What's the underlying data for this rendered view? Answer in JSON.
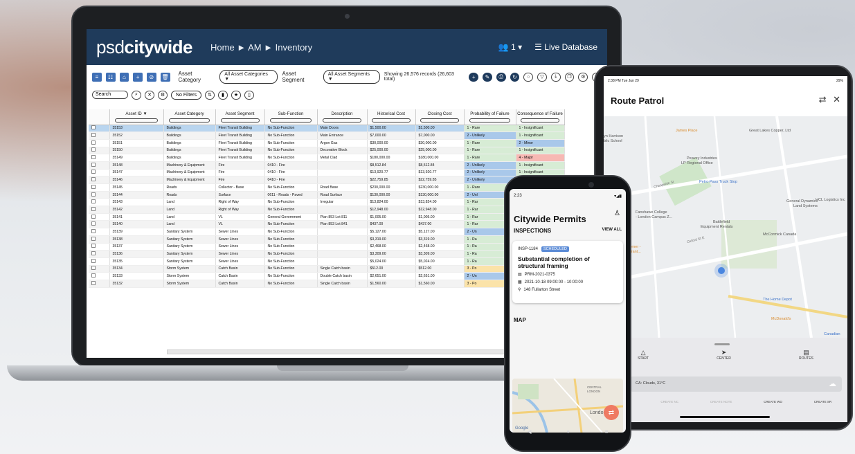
{
  "laptop": {
    "app": {
      "logo_light": "psd",
      "logo_bold": "citywide",
      "breadcrumb": "Home ► AM ► Inventory",
      "user_count": "1 ▾",
      "database": "Live Database"
    },
    "toolbar": {
      "asset_category_label": "Asset Category",
      "asset_category_value": "All Asset Categories ▼",
      "asset_segment_label": "Asset Segment",
      "asset_segment_value": "All Asset Segments ▼",
      "records": "Showing 26,576 records (26,603 total)"
    },
    "search": {
      "placeholder": "Search",
      "filters": "No Filters"
    },
    "columns": [
      "Asset ID ▼",
      "Asset Category",
      "Asset Segment",
      "Sub-Function",
      "Description",
      "Historical Cost",
      "Closing Cost",
      "Probability of Failure",
      "Consequence of Failure"
    ],
    "rows": [
      {
        "id": "35153",
        "cat": "Buildings",
        "seg": "Fleet Transit Building",
        "sub": "No Sub-Function",
        "desc": "Main Doors",
        "hist": "$1,500.00",
        "close": "$1,500.00",
        "prob": "1 - Rare",
        "cons": "1 - Insignificant"
      },
      {
        "id": "35152",
        "cat": "Buildings",
        "seg": "Fleet Transit Building",
        "sub": "No Sub-Function",
        "desc": "Main Entrance",
        "hist": "$7,000.00",
        "close": "$7,000.00",
        "prob": "2 - Unlikely",
        "cons": "1 - Insignificant"
      },
      {
        "id": "35151",
        "cat": "Buildings",
        "seg": "Fleet Transit Building",
        "sub": "No Sub-Function",
        "desc": "Argon Gas",
        "hist": "$30,000.00",
        "close": "$30,000.00",
        "prob": "1 - Rare",
        "cons": "2 - Minor"
      },
      {
        "id": "35150",
        "cat": "Buildings",
        "seg": "Fleet Transit Building",
        "sub": "No Sub-Function",
        "desc": "Decorative Block",
        "hist": "$25,000.00",
        "close": "$25,000.00",
        "prob": "1 - Rare",
        "cons": "1 - Insignificant"
      },
      {
        "id": "35149",
        "cat": "Buildings",
        "seg": "Fleet Transit Building",
        "sub": "No Sub-Function",
        "desc": "Metal Clad",
        "hist": "$180,000.00",
        "close": "$180,000.00",
        "prob": "1 - Rare",
        "cons": "4 - Major"
      },
      {
        "id": "35148",
        "cat": "Machinery & Equipment",
        "seg": "Fire",
        "sub": "0410 - Fire",
        "desc": "",
        "hist": "$8,512.84",
        "close": "$8,512.84",
        "prob": "2 - Unlikely",
        "cons": "1 - Insignificant"
      },
      {
        "id": "35147",
        "cat": "Machinery & Equipment",
        "seg": "Fire",
        "sub": "0410 - Fire",
        "desc": "",
        "hist": "$13,920.77",
        "close": "$13,920.77",
        "prob": "2 - Unlikely",
        "cons": "1 - Insignificant"
      },
      {
        "id": "35146",
        "cat": "Machinery & Equipment",
        "seg": "Fire",
        "sub": "0410 - Fire",
        "desc": "",
        "hist": "$22,759.85",
        "close": "$22,759.85",
        "prob": "2 - Unlikely",
        "cons": "1 - Insignificant"
      },
      {
        "id": "35145",
        "cat": "Roads",
        "seg": "Collector - Base",
        "sub": "No Sub-Function",
        "desc": "Road Base",
        "hist": "$230,000.00",
        "close": "$230,000.00",
        "prob": "1 - Rare",
        "cons": ""
      },
      {
        "id": "35144",
        "cat": "Roads",
        "seg": "Surface",
        "sub": "0611 - Roads - Paved",
        "desc": "Road Surface",
        "hist": "$130,000.00",
        "close": "$130,000.00",
        "prob": "2 - Unl",
        "cons": ""
      },
      {
        "id": "35143",
        "cat": "Land",
        "seg": "Right of Way",
        "sub": "No Sub-Function",
        "desc": "Irregular",
        "hist": "$13,824.00",
        "close": "$13,824.00",
        "prob": "1 - Rar",
        "cons": ""
      },
      {
        "id": "35142",
        "cat": "Land",
        "seg": "Right of Way",
        "sub": "No Sub-Function",
        "desc": "",
        "hist": "$12,948.00",
        "close": "$12,948.00",
        "prob": "1 - Rar",
        "cons": ""
      },
      {
        "id": "35141",
        "cat": "Land",
        "seg": "VL",
        "sub": "General Government",
        "desc": "Plan 853 Lot 811",
        "hist": "$1,005.00",
        "close": "$1,005.00",
        "prob": "1 - Rar",
        "cons": ""
      },
      {
        "id": "35140",
        "cat": "Land",
        "seg": "VL",
        "sub": "No Sub-Function",
        "desc": "Plan 853 Lot 841",
        "hist": "$437.00",
        "close": "$437.00",
        "prob": "1 - Rar",
        "cons": ""
      },
      {
        "id": "35139",
        "cat": "Sanitary System",
        "seg": "Sewer Lines",
        "sub": "No Sub-Function",
        "desc": "",
        "hist": "$5,127.00",
        "close": "$5,127.00",
        "prob": "2 - Un",
        "cons": ""
      },
      {
        "id": "35138",
        "cat": "Sanitary System",
        "seg": "Sewer Lines",
        "sub": "No Sub-Function",
        "desc": "",
        "hist": "$3,319.00",
        "close": "$3,319.00",
        "prob": "1 - Ra",
        "cons": ""
      },
      {
        "id": "35137",
        "cat": "Sanitary System",
        "seg": "Sewer Lines",
        "sub": "No Sub-Function",
        "desc": "",
        "hist": "$2,468.00",
        "close": "$2,468.00",
        "prob": "1 - Ra",
        "cons": ""
      },
      {
        "id": "35136",
        "cat": "Sanitary System",
        "seg": "Sewer Lines",
        "sub": "No Sub-Function",
        "desc": "",
        "hist": "$3,309.00",
        "close": "$3,309.00",
        "prob": "1 - Ra",
        "cons": ""
      },
      {
        "id": "35135",
        "cat": "Sanitary System",
        "seg": "Sewer Lines",
        "sub": "No Sub-Function",
        "desc": "",
        "hist": "$5,024.00",
        "close": "$5,024.00",
        "prob": "1 - Ra",
        "cons": ""
      },
      {
        "id": "35134",
        "cat": "Storm System",
        "seg": "Catch Basin",
        "sub": "No Sub-Function",
        "desc": "Single Catch basin",
        "hist": "$512.00",
        "close": "$512.00",
        "prob": "3 - Po",
        "cons": ""
      },
      {
        "id": "35133",
        "cat": "Storm System",
        "seg": "Catch Basin",
        "sub": "No Sub-Function",
        "desc": "Double Catch basin",
        "hist": "$2,651.00",
        "close": "$2,651.00",
        "prob": "2 - Un",
        "cons": ""
      },
      {
        "id": "35132",
        "cat": "Storm System",
        "seg": "Catch Basin",
        "sub": "No Sub-Function",
        "desc": "Single Catch basin",
        "hist": "$1,560.00",
        "close": "$1,560.00",
        "prob": "3 - Po",
        "cons": ""
      }
    ]
  },
  "tablet": {
    "status_time": "2:38 PM  Tue Jun 29",
    "status_right": "29%",
    "title": "Route Patrol",
    "map_labels": [
      "James Place",
      "Great Lakes Copper, Ltd",
      "yn Harrison",
      "blic School",
      "Peavey Industries",
      "LP Regional Office",
      "Petro-Pass Truck Stop",
      "Fanshawe College",
      "- London Campus Z...",
      "Battlefield",
      "Equipment Rentals",
      "General Dynamics",
      "Land Systems",
      "HCL Logistics Inc",
      "McCormick Canada",
      "Gigis Spice Corner -",
      "st Indian Restaurant...",
      "The Home Depot",
      "McDonald's",
      "Canadian",
      "Oxford St E",
      "Cheapside St"
    ],
    "nav": [
      "START",
      "CENTER",
      "ROUTES"
    ],
    "weather": "CA: Clouds, 31°C",
    "actions": [
      "STATS",
      "CREATE NC",
      "CREATE NOTE",
      "CREATE WO",
      "CREATE SR"
    ]
  },
  "phone": {
    "status_time": "2:23",
    "title": "Citywide Permits",
    "section": "INSPECTIONS",
    "view_all": "VIEW ALL",
    "card": {
      "id": "INSP-1184",
      "badge": "SCHEDULED",
      "title": "Substantial completion of structural framing",
      "permit": "PRM-2021-0375",
      "datetime": "2021-10-18 09:00:00 - 10:00:00",
      "address": "148 Fullarton Street"
    },
    "map_label": "MAP",
    "map_texts": [
      "CENTRAL",
      "LONDON",
      "London",
      "Google"
    ]
  }
}
